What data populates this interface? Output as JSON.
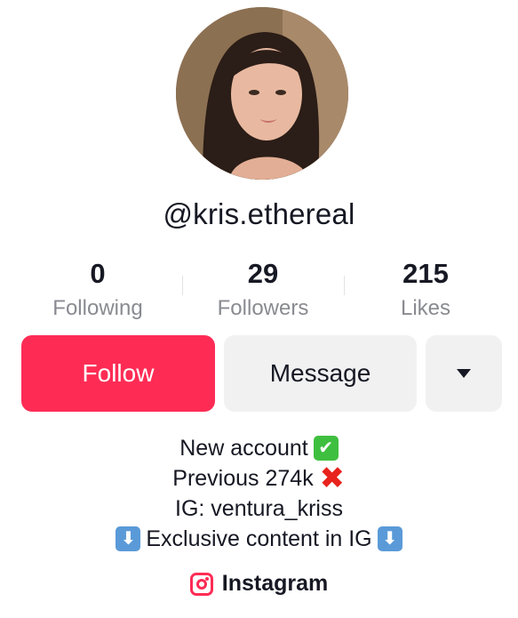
{
  "profile": {
    "username": "@kris.ethereal",
    "avatar": "profile-photo"
  },
  "stats": {
    "following": {
      "value": "0",
      "label": "Following"
    },
    "followers": {
      "value": "29",
      "label": "Followers"
    },
    "likes": {
      "value": "215",
      "label": "Likes"
    }
  },
  "actions": {
    "follow_label": "Follow",
    "message_label": "Message",
    "more_icon": "caret-down-icon"
  },
  "bio": {
    "line1": "New account",
    "line1_emoji": "✔",
    "line2": "Previous 274k",
    "line2_emoji": "✖",
    "line3": "IG: ventura_kriss",
    "line4": "Exclusive content in IG",
    "line4_emoji": "⬇"
  },
  "link": {
    "label": "Instagram",
    "icon": "instagram-icon"
  },
  "colors": {
    "accent": "#fe2c55",
    "secondary_button": "#f1f1f2",
    "muted_text": "#8a8b91",
    "text": "#161823"
  }
}
